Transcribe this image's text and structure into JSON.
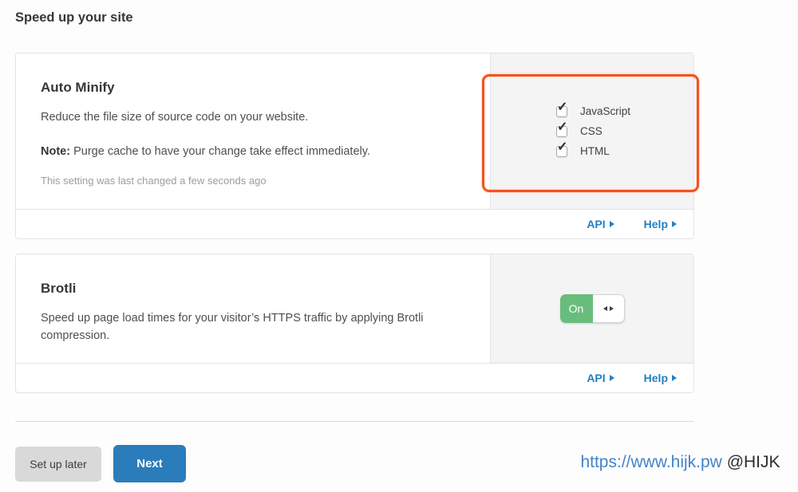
{
  "page_title": "Speed up your site",
  "colors": {
    "accent_orange": "#f5521d",
    "toggle_green": "#69bd7c",
    "link_blue": "#2380c1",
    "primary_button_blue": "#2b7cba"
  },
  "cards": [
    {
      "title": "Auto Minify",
      "description": "Reduce the file size of source code on your website.",
      "note_label": "Note:",
      "note_text": "Purge cache to have your change take effect immediately.",
      "status_text": "This setting was last changed a few seconds ago",
      "options": [
        {
          "label": "JavaScript",
          "checked": true
        },
        {
          "label": "CSS",
          "checked": true
        },
        {
          "label": "HTML",
          "checked": true
        }
      ],
      "api_link": "API",
      "help_link": "Help"
    },
    {
      "title": "Brotli",
      "description": "Speed up page load times for your visitor’s HTTPS traffic by applying Brotli compression.",
      "toggle_state": "On",
      "api_link": "API",
      "help_link": "Help"
    }
  ],
  "actions": {
    "secondary_label": "Set up later",
    "primary_label": "Next"
  },
  "watermark": {
    "url_text": "https://www.hijk.pw",
    "handle_text": "@HIJK"
  }
}
